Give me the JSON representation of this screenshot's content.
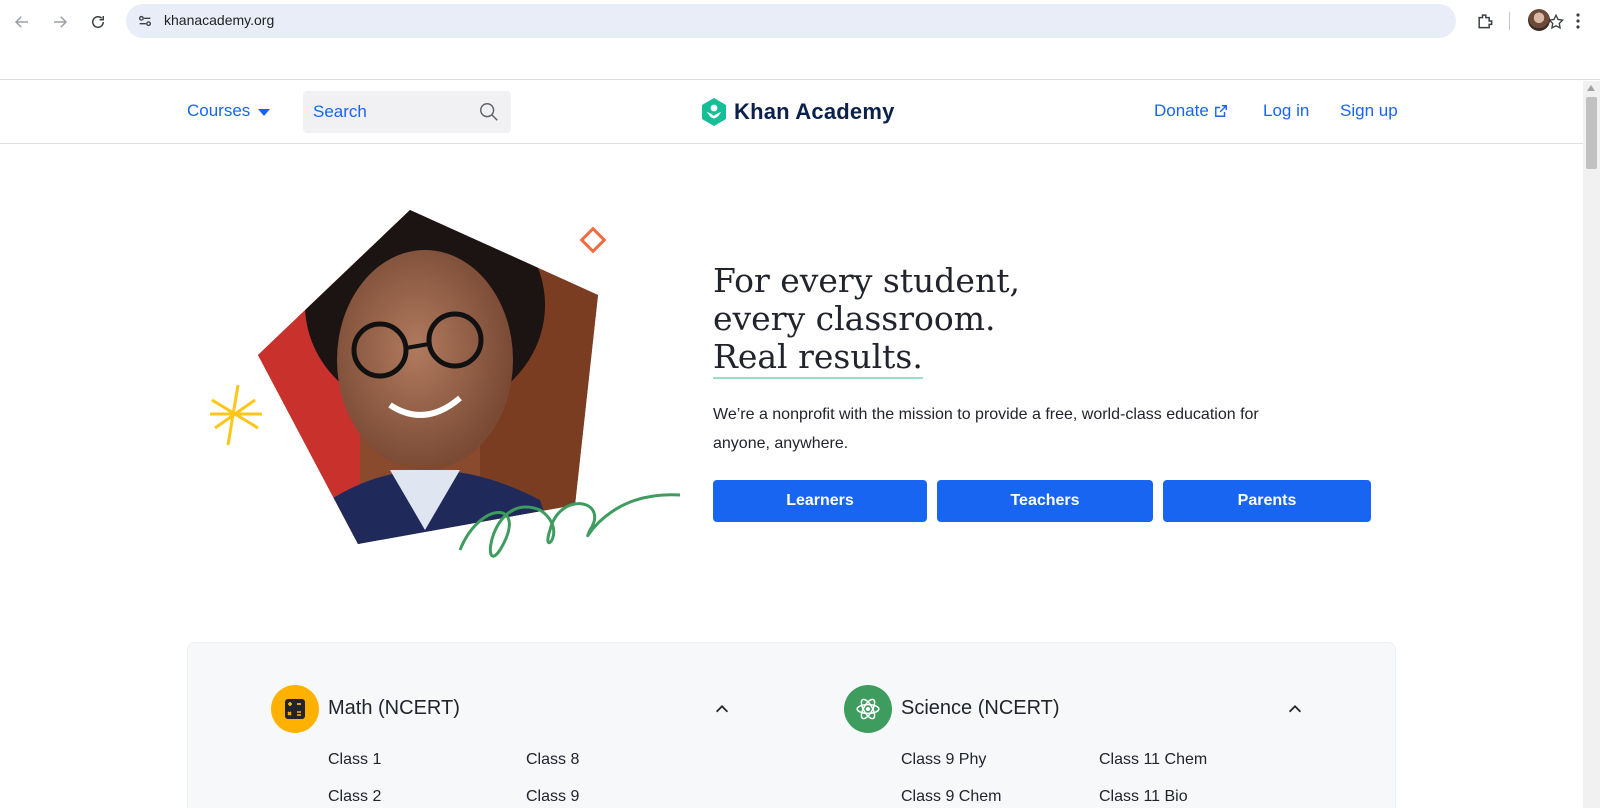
{
  "browser": {
    "url": "khanacademy.org",
    "icons": [
      "back-icon",
      "forward-icon",
      "reload-icon",
      "site-info-icon",
      "star-icon",
      "extensions-icon",
      "profile-avatar",
      "more-icon"
    ]
  },
  "header": {
    "courses_label": "Courses",
    "search_placeholder": "Search",
    "logo_text": "Khan Academy",
    "donate_label": "Donate",
    "login_label": "Log in",
    "signup_label": "Sign up"
  },
  "hero": {
    "title_line1": "For every student,",
    "title_line2": "every classroom.",
    "title_line3": "Real results.",
    "subtitle": "We’re a nonprofit with the mission to provide a free, world-class education for anyone, anywhere.",
    "buttons": {
      "learners": "Learners",
      "teachers": "Teachers",
      "parents": "Parents"
    }
  },
  "courses": {
    "math": {
      "title": "Math (NCERT)",
      "links": [
        "Class 1",
        "Class 8",
        "Class 2",
        "Class 9"
      ]
    },
    "science": {
      "title": "Science (NCERT)",
      "links": [
        "Class 9 Phy",
        "Class 11 Chem",
        "Class 9 Chem",
        "Class 11 Bio"
      ]
    }
  },
  "colors": {
    "brand_blue": "#1865f2",
    "logo_green": "#14bf96",
    "math_icon_bg": "#ffb100",
    "science_icon_bg": "#3d9c5e"
  }
}
